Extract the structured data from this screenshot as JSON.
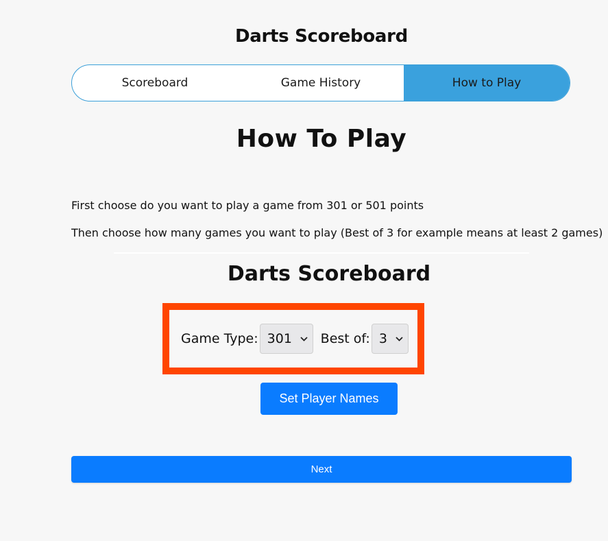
{
  "header": {
    "title": "Darts Scoreboard"
  },
  "tabs": [
    {
      "label": "Scoreboard",
      "active": false
    },
    {
      "label": "Game History",
      "active": false
    },
    {
      "label": "How to Play",
      "active": true
    }
  ],
  "main": {
    "title": "How To Play",
    "paragraphs": [
      "First choose do you want to play a game from 301 or 501 points",
      "Then choose how many games you want to play (Best of 3 for example means at least 2 games)"
    ]
  },
  "demo": {
    "title": "Darts Scoreboard",
    "game_type_label": "Game Type:",
    "game_type_value": "301",
    "best_of_label": "Best of:",
    "best_of_value": "3",
    "set_players_label": "Set Player Names",
    "highlight_color": "#ff4500",
    "chevron_icon": "chevron-down-icon"
  },
  "footer": {
    "next_label": "Next"
  },
  "colors": {
    "accent": "#3aa1dd",
    "primary_button": "#0a7cff",
    "background": "#f7f7f7"
  }
}
